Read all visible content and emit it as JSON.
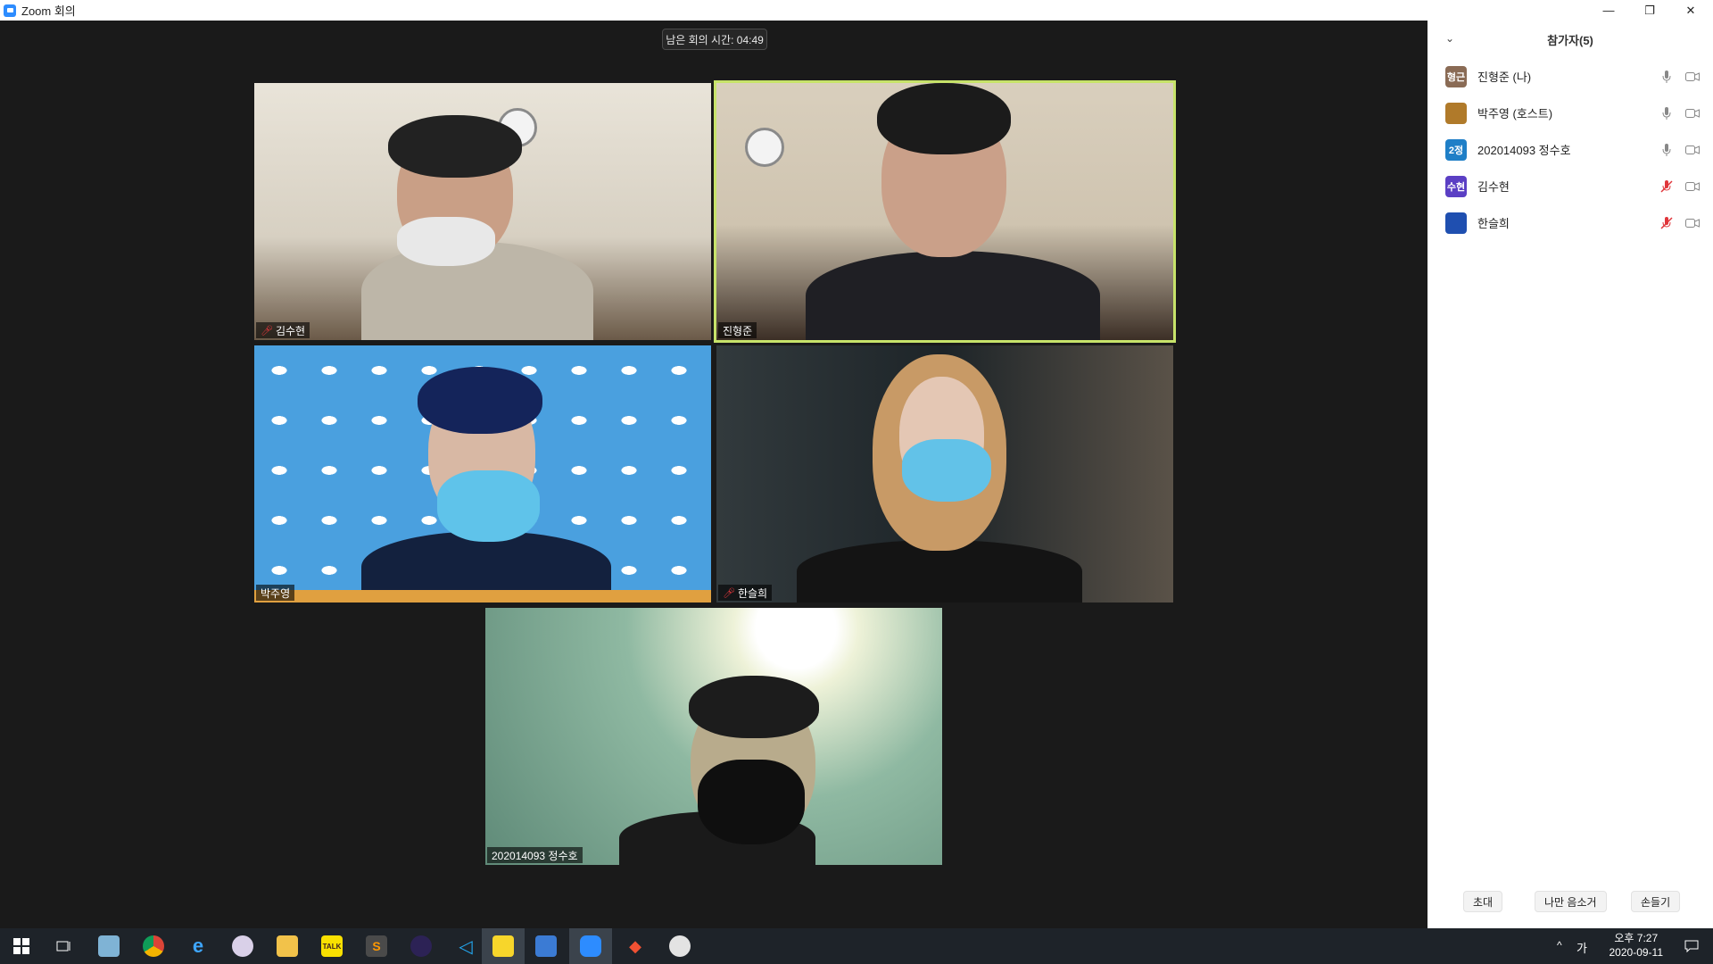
{
  "window": {
    "title": "Zoom 회의",
    "minimize": "—",
    "restore": "❐",
    "close": "✕"
  },
  "meeting": {
    "timer": "남은 회의 시간: 04:49",
    "tiles": [
      {
        "name": "김수현",
        "muted": true
      },
      {
        "name": "진형준",
        "muted": false,
        "active": true
      },
      {
        "name": "박주영",
        "muted": false
      },
      {
        "name": "한슬희",
        "muted": true
      },
      {
        "name": "202014093 정수호",
        "muted": false
      }
    ]
  },
  "panel": {
    "collapse_icon": "⌄",
    "title": "참가자(5)",
    "participants": [
      {
        "avatar_text": "형근",
        "avatar_color": "#8a6b55",
        "name": "진형준 (나)",
        "mic": "on"
      },
      {
        "avatar_text": "",
        "avatar_color": "#b07a2a",
        "name": "박주영 (호스트)",
        "mic": "on"
      },
      {
        "avatar_text": "2정",
        "avatar_color": "#1f7fc7",
        "name": "202014093 정수호",
        "mic": "on"
      },
      {
        "avatar_text": "수현",
        "avatar_color": "#5b3fc4",
        "name": "김수현",
        "mic": "muted"
      },
      {
        "avatar_text": "",
        "avatar_color": "#1f4fb0",
        "name": "한슬희",
        "mic": "muted"
      }
    ],
    "buttons": {
      "invite": "초대",
      "mute_me": "나만 음소거",
      "raise_hand": "손들기"
    }
  },
  "taskbar": {
    "ime": "가",
    "time": "오후 7:27",
    "date": "2020-09-11",
    "tray_chevron": "^"
  },
  "colors": {
    "active_speaker": "#c7e36a",
    "zoom_blue": "#2d8cff",
    "muted_red": "#e0363b"
  }
}
